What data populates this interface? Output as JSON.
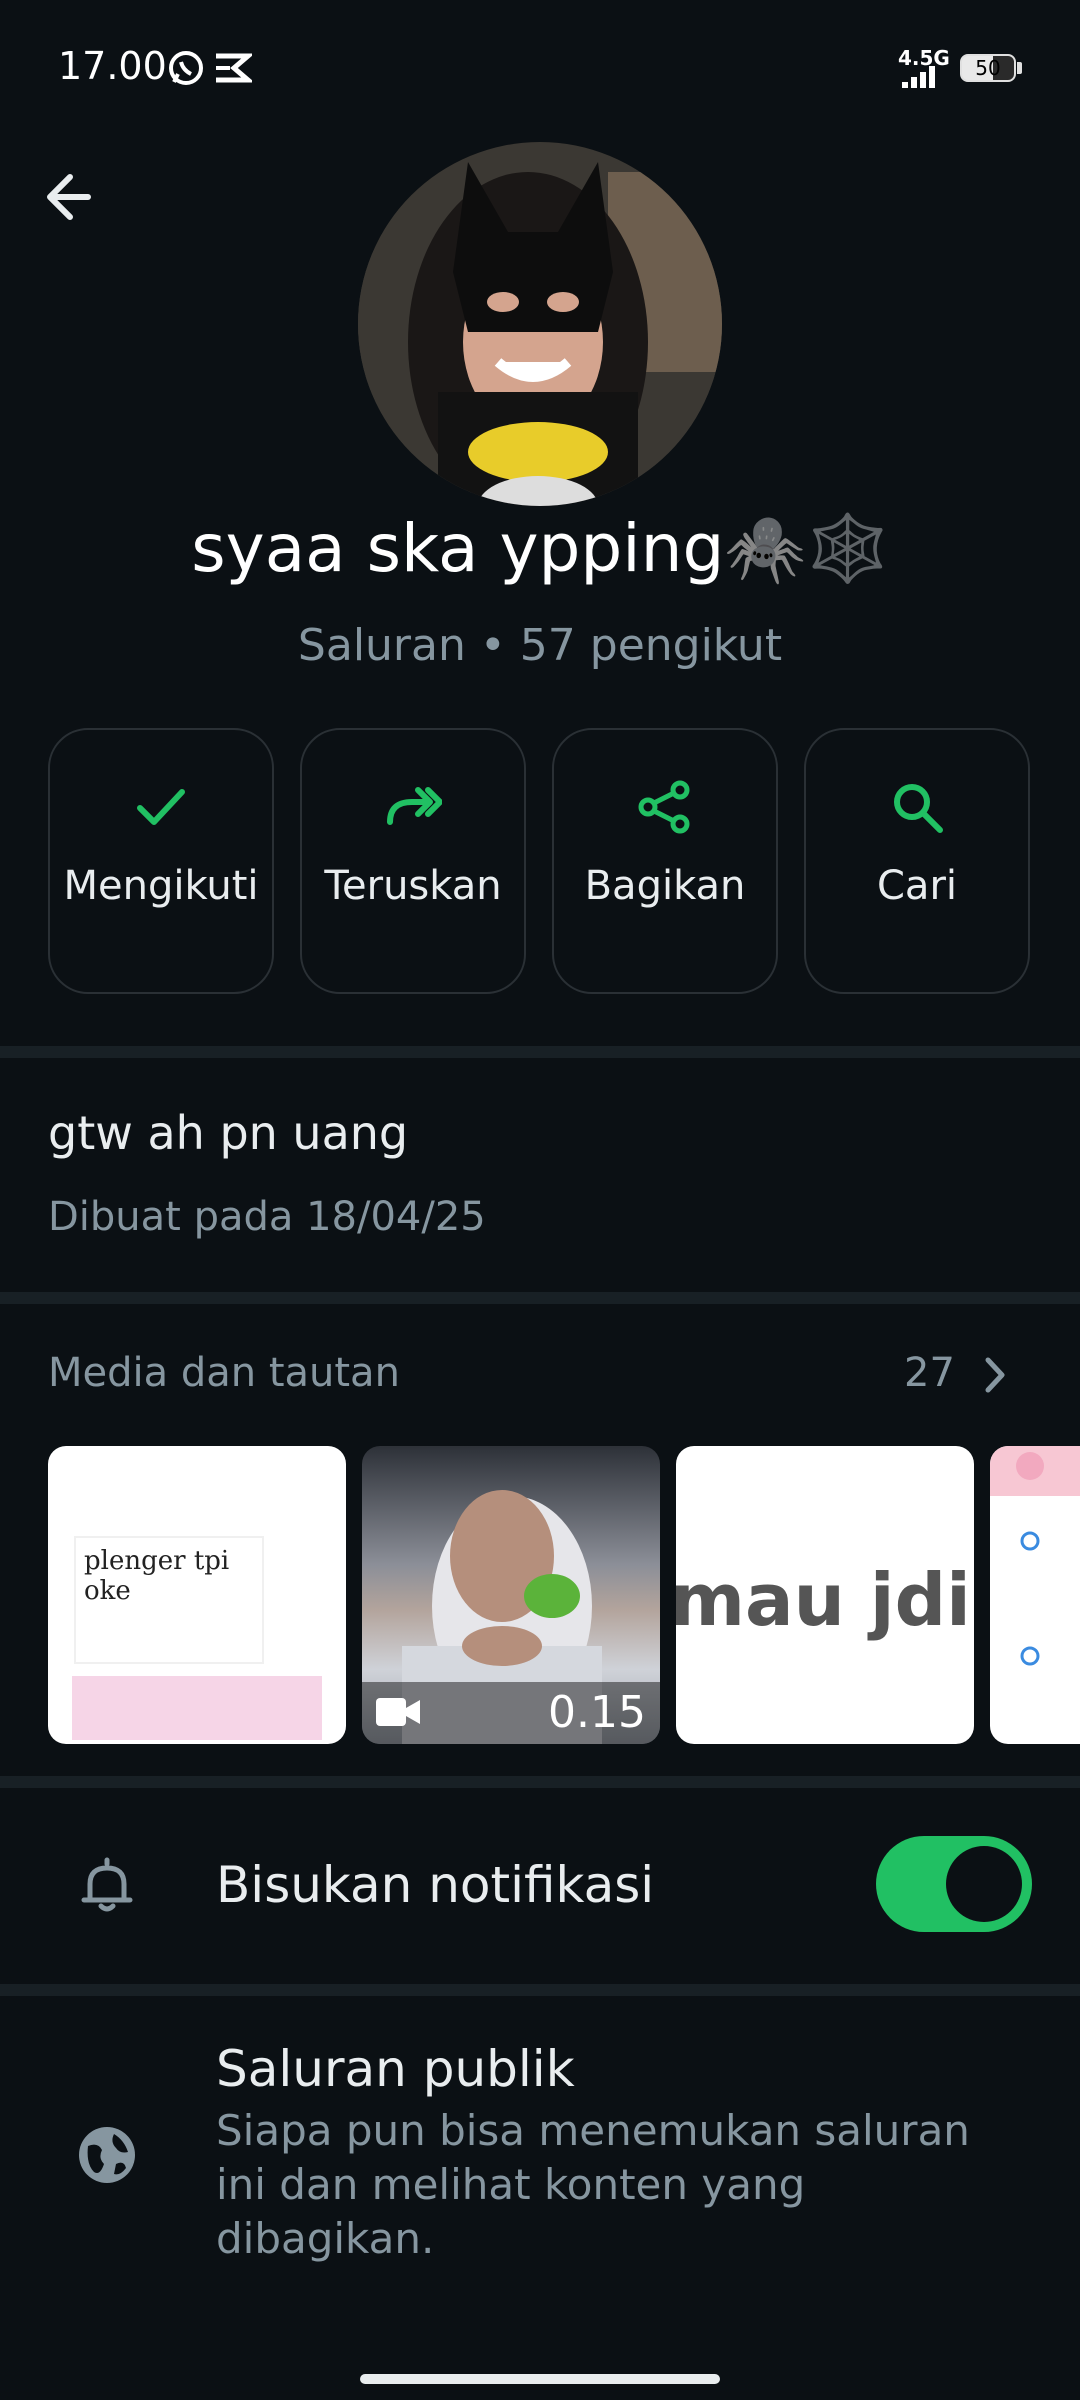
{
  "status_bar": {
    "time": "17.00",
    "network": "4.5G",
    "battery": "50"
  },
  "profile": {
    "name": "syaa ska ypping🕷️🕸️",
    "subtitle": "Saluran • 57 pengikut"
  },
  "actions": [
    {
      "label": "Mengikuti",
      "icon": "check-icon"
    },
    {
      "label": "Teruskan",
      "icon": "forward-icon"
    },
    {
      "label": "Bagikan",
      "icon": "share-icon"
    },
    {
      "label": "Cari",
      "icon": "search-icon"
    }
  ],
  "description": {
    "text": "gtw ah pn uang",
    "created": "Dibuat pada 18/04/25"
  },
  "media": {
    "title": "Media dan tautan",
    "count": "27",
    "video_duration": "0.15",
    "thumb3_text": "mau jdi c",
    "thumb1_sticker": "plenger tpi oke"
  },
  "settings": {
    "mute_label": "Bisukan notifikasi",
    "mute_on": true,
    "public_title": "Saluran publik",
    "public_desc": "Siapa pun bisa menemukan saluran ini dan melihat konten yang dibagikan."
  },
  "colors": {
    "accent": "#21c063",
    "background": "#0b1014",
    "muted_text": "#8696a0"
  }
}
